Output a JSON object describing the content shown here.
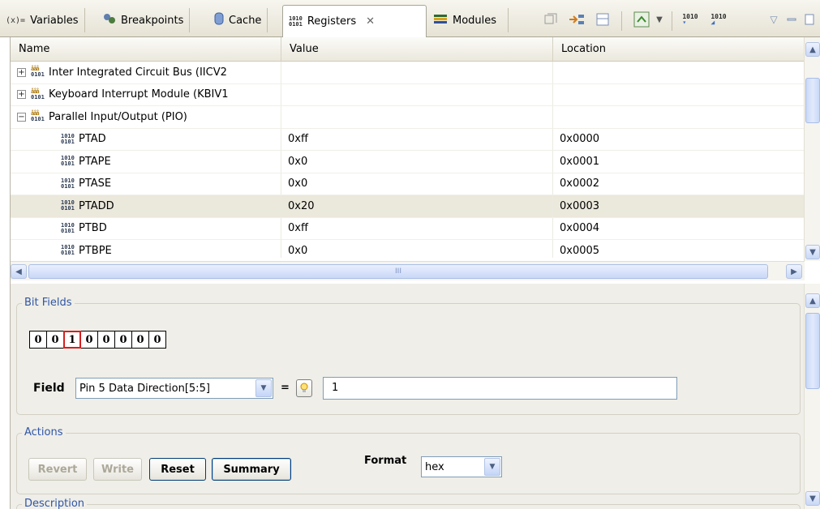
{
  "tabs": [
    {
      "label": "Variables",
      "icon": "variables-icon",
      "glyph": "(x)="
    },
    {
      "label": "Breakpoints",
      "icon": "breakpoints-icon"
    },
    {
      "label": "Cache",
      "icon": "cache-icon"
    },
    {
      "label": "Registers",
      "icon": "registers-icon",
      "active": true
    },
    {
      "label": "Modules",
      "icon": "modules-icon"
    }
  ],
  "toolbar_icons": [
    "collapse-all-icon",
    "show-type-icon",
    "layout-icon",
    "sync-icon",
    "chevron-down-icon",
    "bits-prev-icon",
    "bits-next-icon",
    "view-menu-icon",
    "minimize-icon",
    "maximize-icon"
  ],
  "table": {
    "headers": [
      "Name",
      "Value",
      "Location"
    ],
    "rows": [
      {
        "name": "Inter Integrated Circuit Bus (IICV2",
        "value": "",
        "location": "",
        "type": "group",
        "expanded": false
      },
      {
        "name": "Keyboard Interrupt Module (KBIV1",
        "value": "",
        "location": "",
        "type": "group",
        "expanded": false
      },
      {
        "name": "Parallel Input/Output (PIO)",
        "value": "",
        "location": "",
        "type": "group",
        "expanded": true
      },
      {
        "name": "PTAD",
        "value": "0xff",
        "location": "0x0000",
        "type": "register"
      },
      {
        "name": "PTAPE",
        "value": "0x0",
        "location": "0x0001",
        "type": "register"
      },
      {
        "name": "PTASE",
        "value": "0x0",
        "location": "0x0002",
        "type": "register"
      },
      {
        "name": "PTADD",
        "value": "0x20",
        "location": "0x0003",
        "type": "register",
        "selected": true
      },
      {
        "name": "PTBD",
        "value": "0xff",
        "location": "0x0004",
        "type": "register"
      },
      {
        "name": "PTBPE",
        "value": "0x0",
        "location": "0x0005",
        "type": "register"
      }
    ],
    "hscroll_grip": "III"
  },
  "bit_fields": {
    "legend": "Bit Fields",
    "bits": [
      "0",
      "0",
      "1",
      "0",
      "0",
      "0",
      "0",
      "0"
    ],
    "highlighted_bit": 2,
    "field_label": "Field",
    "field_value": "Pin 5 Data Direction[5:5]",
    "equals": "=",
    "value_text": "1"
  },
  "actions": {
    "legend": "Actions",
    "revert": "Revert",
    "write": "Write",
    "reset": "Reset",
    "summary": "Summary",
    "format_label": "Format",
    "format_value": "hex"
  },
  "description": {
    "legend": "Description"
  },
  "colors": {
    "selected_row": "#ebe8dc",
    "legend_text": "#2f56a6",
    "highlighted_bit_border": "#d62020"
  }
}
